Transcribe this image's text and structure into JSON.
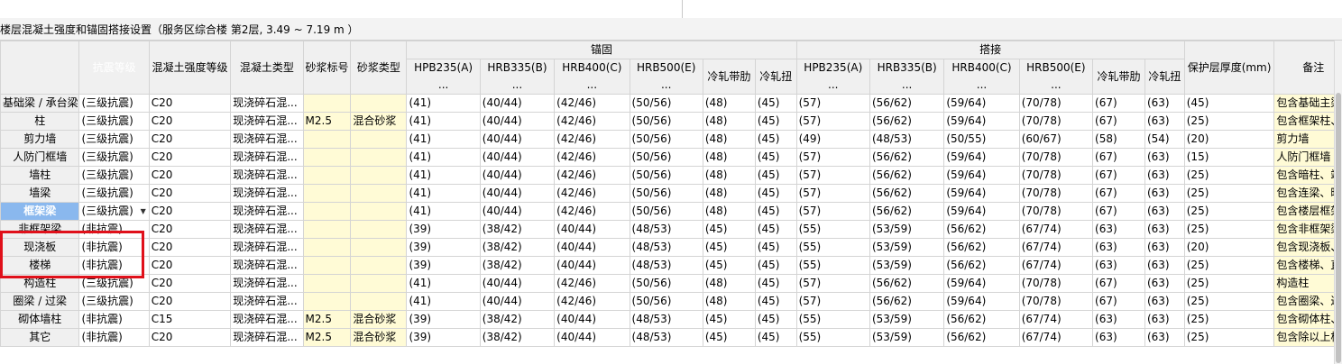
{
  "title": "楼层混凝土强度和锚固搭接设置（服务区综合楼  第2层, 3.49 ~ 7.19 m ）",
  "groups": {
    "anchor": "锚固",
    "lap": "搭接"
  },
  "headers": {
    "seismic": "抗震等级",
    "concrete_grade": "混凝土强度等级",
    "concrete_type": "混凝土类型",
    "mortar_grade": "砂浆标号",
    "mortar_type": "砂浆类型",
    "hpb235": "HPB235(A)\n...",
    "hrb335": "HRB335(B)\n...",
    "hrb400": "HRB400(C)\n...",
    "hrb500": "HRB500(E)\n...",
    "cold_rib": "冷轧带肋",
    "cold_twist": "冷轧扭",
    "cover": "保护层厚度(mm)",
    "note": "备注"
  },
  "rows": [
    {
      "name": "基础梁 / 承台梁",
      "seismic": "(三级抗震)",
      "cg": "C20",
      "ct": "现浇碎石混...",
      "mg": "",
      "mt": "",
      "a1": "(41)",
      "a2": "(40/44)",
      "a3": "(42/46)",
      "a4": "(50/56)",
      "a5": "(48)",
      "a6": "(45)",
      "l1": "(57)",
      "l2": "(56/62)",
      "l3": "(59/64)",
      "l4": "(70/78)",
      "l5": "(67)",
      "l6": "(63)",
      "cover": "(45)",
      "note": "包含基础主梁、"
    },
    {
      "name": "柱",
      "seismic": "(三级抗震)",
      "cg": "C20",
      "ct": "现浇碎石混...",
      "mg": "M2.5",
      "mt": "混合砂浆",
      "a1": "(41)",
      "a2": "(40/44)",
      "a3": "(42/46)",
      "a4": "(50/56)",
      "a5": "(48)",
      "a6": "(45)",
      "l1": "(57)",
      "l2": "(56/62)",
      "l3": "(59/64)",
      "l4": "(70/78)",
      "l5": "(67)",
      "l6": "(63)",
      "cover": "(25)",
      "note": "包含框架柱、"
    },
    {
      "name": "剪力墙",
      "seismic": "(三级抗震)",
      "cg": "C20",
      "ct": "现浇碎石混...",
      "mg": "",
      "mt": "",
      "a1": "(41)",
      "a2": "(40/44)",
      "a3": "(42/46)",
      "a4": "(50/56)",
      "a5": "(48)",
      "a6": "(45)",
      "l1": "(49)",
      "l2": "(48/53)",
      "l3": "(50/55)",
      "l4": "(60/67)",
      "l5": "(58)",
      "l6": "(54)",
      "cover": "(20)",
      "note": "剪力墙"
    },
    {
      "name": "人防门框墙",
      "seismic": "(三级抗震)",
      "cg": "C20",
      "ct": "现浇碎石混...",
      "mg": "",
      "mt": "",
      "a1": "(41)",
      "a2": "(40/44)",
      "a3": "(42/46)",
      "a4": "(50/56)",
      "a5": "(48)",
      "a6": "(45)",
      "l1": "(57)",
      "l2": "(56/62)",
      "l3": "(59/64)",
      "l4": "(70/78)",
      "l5": "(67)",
      "l6": "(63)",
      "cover": "(15)",
      "note": "人防门框墙"
    },
    {
      "name": "墙柱",
      "seismic": "(三级抗震)",
      "cg": "C20",
      "ct": "现浇碎石混...",
      "mg": "",
      "mt": "",
      "a1": "(41)",
      "a2": "(40/44)",
      "a3": "(42/46)",
      "a4": "(50/56)",
      "a5": "(48)",
      "a6": "(45)",
      "l1": "(57)",
      "l2": "(56/62)",
      "l3": "(59/64)",
      "l4": "(70/78)",
      "l5": "(67)",
      "l6": "(63)",
      "cover": "(25)",
      "note": "包含暗柱、端"
    },
    {
      "name": "墙梁",
      "seismic": "(三级抗震)",
      "cg": "C20",
      "ct": "现浇碎石混...",
      "mg": "",
      "mt": "",
      "a1": "(41)",
      "a2": "(40/44)",
      "a3": "(42/46)",
      "a4": "(50/56)",
      "a5": "(48)",
      "a6": "(45)",
      "l1": "(57)",
      "l2": "(56/62)",
      "l3": "(59/64)",
      "l4": "(70/78)",
      "l5": "(67)",
      "l6": "(63)",
      "cover": "(25)",
      "note": "包含连梁、暗"
    },
    {
      "name": "框架梁",
      "seismic": "(三级抗震)",
      "cg": "C20",
      "ct": "现浇碎石混...",
      "mg": "",
      "mt": "",
      "a1": "(41)",
      "a2": "(40/44)",
      "a3": "(42/46)",
      "a4": "(50/56)",
      "a5": "(48)",
      "a6": "(45)",
      "l1": "(57)",
      "l2": "(56/62)",
      "l3": "(59/64)",
      "l4": "(70/78)",
      "l5": "(67)",
      "l6": "(63)",
      "cover": "(25)",
      "note": "包含楼层框架"
    },
    {
      "name": "非框架梁",
      "seismic": "(非抗震)",
      "cg": "C20",
      "ct": "现浇碎石混...",
      "mg": "",
      "mt": "",
      "a1": "(39)",
      "a2": "(38/42)",
      "a3": "(40/44)",
      "a4": "(48/53)",
      "a5": "(45)",
      "a6": "(45)",
      "l1": "(55)",
      "l2": "(53/59)",
      "l3": "(56/62)",
      "l4": "(67/74)",
      "l5": "(63)",
      "l6": "(63)",
      "cover": "(25)",
      "note": "包含非框架梁"
    },
    {
      "name": "现浇板",
      "seismic": "(非抗震)",
      "cg": "C20",
      "ct": "现浇碎石混...",
      "mg": "",
      "mt": "",
      "a1": "(39)",
      "a2": "(38/42)",
      "a3": "(40/44)",
      "a4": "(48/53)",
      "a5": "(45)",
      "a6": "(45)",
      "l1": "(55)",
      "l2": "(53/59)",
      "l3": "(56/62)",
      "l4": "(67/74)",
      "l5": "(63)",
      "l6": "(63)",
      "cover": "(20)",
      "note": "包含现浇板、"
    },
    {
      "name": "楼梯",
      "seismic": "(非抗震)",
      "cg": "C20",
      "ct": "现浇碎石混...",
      "mg": "",
      "mt": "",
      "a1": "(39)",
      "a2": "(38/42)",
      "a3": "(40/44)",
      "a4": "(48/53)",
      "a5": "(45)",
      "a6": "(45)",
      "l1": "(55)",
      "l2": "(53/59)",
      "l3": "(56/62)",
      "l4": "(67/74)",
      "l5": "(63)",
      "l6": "(63)",
      "cover": "(25)",
      "note": "包含楼梯、直"
    },
    {
      "name": "构造柱",
      "seismic": "(三级抗震)",
      "cg": "C20",
      "ct": "现浇碎石混...",
      "mg": "",
      "mt": "",
      "a1": "(41)",
      "a2": "(40/44)",
      "a3": "(42/46)",
      "a4": "(50/56)",
      "a5": "(48)",
      "a6": "(45)",
      "l1": "(57)",
      "l2": "(56/62)",
      "l3": "(59/64)",
      "l4": "(70/78)",
      "l5": "(67)",
      "l6": "(63)",
      "cover": "(25)",
      "note": "构造柱"
    },
    {
      "name": "圈梁 / 过梁",
      "seismic": "(三级抗震)",
      "cg": "C20",
      "ct": "现浇碎石混...",
      "mg": "",
      "mt": "",
      "a1": "(41)",
      "a2": "(40/44)",
      "a3": "(42/46)",
      "a4": "(50/56)",
      "a5": "(48)",
      "a6": "(45)",
      "l1": "(57)",
      "l2": "(56/62)",
      "l3": "(59/64)",
      "l4": "(70/78)",
      "l5": "(67)",
      "l6": "(63)",
      "cover": "(25)",
      "note": "包含圈梁、过"
    },
    {
      "name": "砌体墙柱",
      "seismic": "(非抗震)",
      "cg": "C15",
      "ct": "现浇碎石混...",
      "mg": "M2.5",
      "mt": "混合砂浆",
      "a1": "(39)",
      "a2": "(38/42)",
      "a3": "(40/44)",
      "a4": "(48/53)",
      "a5": "(45)",
      "a6": "(45)",
      "l1": "(55)",
      "l2": "(53/59)",
      "l3": "(56/62)",
      "l4": "(67/74)",
      "l5": "(63)",
      "l6": "(63)",
      "cover": "(25)",
      "note": "包含砌体柱、"
    },
    {
      "name": "其它",
      "seismic": "(非抗震)",
      "cg": "C20",
      "ct": "现浇碎石混...",
      "mg": "M2.5",
      "mt": "混合砂浆",
      "a1": "(39)",
      "a2": "(38/42)",
      "a3": "(40/44)",
      "a4": "(48/53)",
      "a5": "(45)",
      "a6": "(45)",
      "l1": "(55)",
      "l2": "(53/59)",
      "l3": "(56/62)",
      "l4": "(67/74)",
      "l5": "(63)",
      "l6": "(63)",
      "cover": "(25)",
      "note": "包含除以上构"
    }
  ],
  "active_row_index": 6,
  "highlight_color": "#8ab8ee",
  "annotation_color": "#e0101a"
}
